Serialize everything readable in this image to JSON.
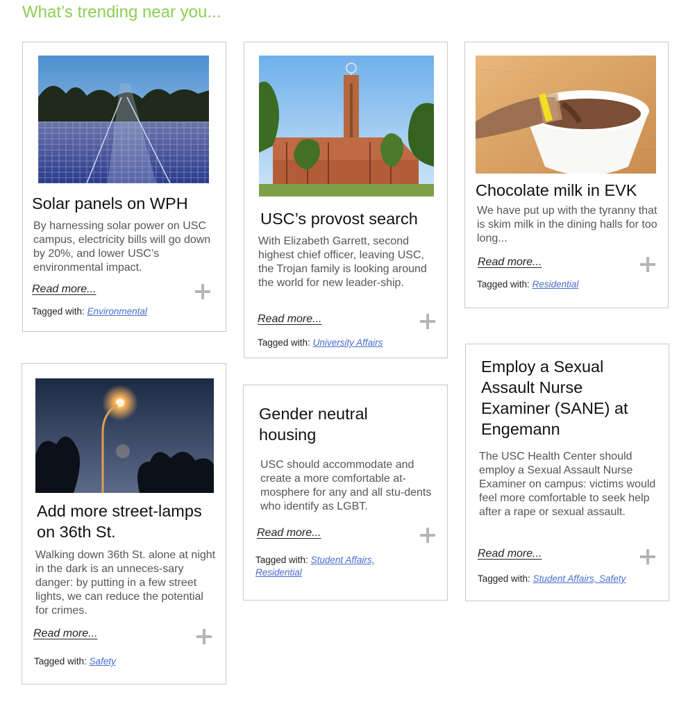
{
  "heading": "What’s trending near you...",
  "cards": [
    {
      "title": "Solar panels on WPH",
      "description": "By harnessing solar power on USC campus, electricity bills will go down by 20%, and lower USC’s environmental impact.",
      "read_more": "Read more...",
      "tagged_label": "Tagged with:",
      "tags": "Environmental"
    },
    {
      "title": "USC’s provost search",
      "description": "With Elizabeth Garrett, second highest chief officer, leaving USC, the Trojan family is looking around the world for new leader-ship.",
      "read_more": "Read more...",
      "tagged_label": "Tagged with:",
      "tags": "University Affairs"
    },
    {
      "title": "Chocolate milk in EVK",
      "description": "We have put up with the tyranny that is skim milk in the dining halls for too long...",
      "read_more": "Read more...",
      "tagged_label": "Tagged with:",
      "tags": "Residential"
    },
    {
      "title": "Add more street-lamps on 36th St.",
      "description": "Walking down 36th St. alone at night in the dark is an unneces-sary danger: by putting in a few street lights, we can reduce the potential for crimes.",
      "read_more": "Read more...",
      "tagged_label": "Tagged with:",
      "tags": "Safety"
    },
    {
      "title": "Gender neutral housing",
      "description": "USC should accommodate and create a more comfortable at-mosphere for any and all stu-dents who identify as LGBT.",
      "read_more": "Read more...",
      "tagged_label": "Tagged with:",
      "tags": "Student Affairs, Residential"
    },
    {
      "title": "Employ a Sexual Assault Nurse Examiner (SANE) at Engemann",
      "description": "The USC Health Center should employ a Sexual Assault Nurse Examiner on campus: victims would feel more comfortable to seek help after a rape or sexual assault.",
      "read_more": "Read more...",
      "tagged_label": "Tagged with:",
      "tags": "Student Affairs, Safety"
    }
  ],
  "icons": {
    "expand": "plus-icon"
  }
}
